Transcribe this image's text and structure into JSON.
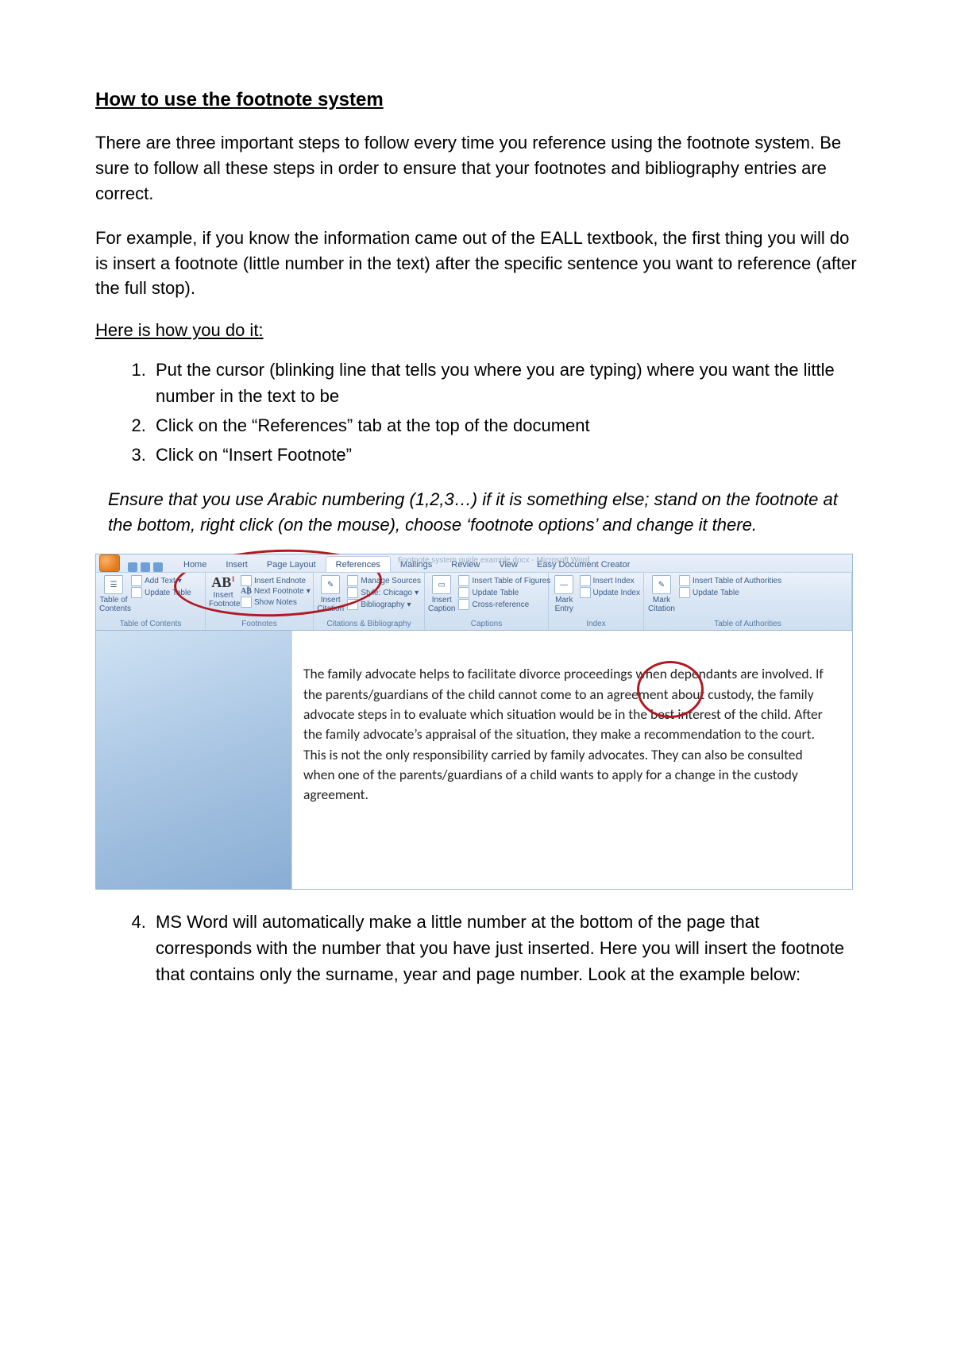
{
  "title": "How to use the footnote system",
  "para1": "There are three important steps to follow every time you reference using the footnote system. Be sure to follow all these steps in order to ensure that your footnotes and bibliography entries are correct.",
  "para2": "For example, if you know the information came out of the EALL textbook, the first thing you will do is insert a footnote (little number in the text) after the specific sentence you want to reference (after the full stop).",
  "subhead": "Here is how you do it:",
  "steps": [
    "Put the cursor (blinking line that tells you where you are typing) where you want the little number in the text to be",
    "Click on the “References” tab at the top of the document",
    "Click on “Insert Footnote”"
  ],
  "italic_note": "Ensure that you use Arabic numbering (1,2,3…) if it is something else; stand on the footnote at the bottom, right click (on the mouse), choose ‘footnote options’ and change it there.",
  "step4": "MS Word will automatically make a little number at the bottom of the page that corresponds with the number that you have just inserted. Here you will insert the footnote that contains only the surname, year and page number. Look at the example below:",
  "ribbon": {
    "tabs": {
      "home": "Home",
      "insert": "Insert",
      "page_layout": "Page Layout",
      "references": "References",
      "mailings": "Mailings",
      "review": "Review",
      "view": "View",
      "easy": "Easy Document Creator"
    },
    "titlebar": "Footnote system guide example.docx  -  Microsoft Word",
    "groups": {
      "toc": {
        "name": "Table of Contents",
        "btn": "Table of\nContents",
        "add_text": "Add Text",
        "update": "Update Table"
      },
      "footnotes": {
        "name": "Footnotes",
        "ab": "AB",
        "btn": "Insert\nFootnote",
        "endnote": "Insert Endnote",
        "next": "Next Footnote",
        "show": "Show Notes"
      },
      "cit": {
        "name": "Citations & Bibliography",
        "btn": "Insert\nCitation",
        "manage": "Manage Sources",
        "style_lbl": "Style:",
        "style_val": "Chicago",
        "bib": "Bibliography"
      },
      "captions": {
        "name": "Captions",
        "btn": "Insert\nCaption",
        "fig": "Insert Table of Figures",
        "update": "Update Table",
        "cross": "Cross-reference"
      },
      "index": {
        "name": "Index",
        "btn": "Mark\nEntry",
        "ins": "Insert Index",
        "update": "Update Index"
      },
      "toa": {
        "name": "Table of Authorities",
        "btn": "Mark\nCitation",
        "ins": "Insert Table of Authorities",
        "update": "Update Table"
      }
    },
    "doc_text": "The family advocate helps to facilitate divorce proceedings when dependants are involved. If the parents/guardians of the child cannot come to an agreement about custody, the family advocate steps in to evaluate which situation would be in the best interest of the child. After the family advocate’s appraisal of the situation, they make a recommendation to the court. This is not the only responsibility carried by family advocates. They can also be consulted when one of the parents/guardians of a child wants to apply for a change in the custody agreement."
  }
}
